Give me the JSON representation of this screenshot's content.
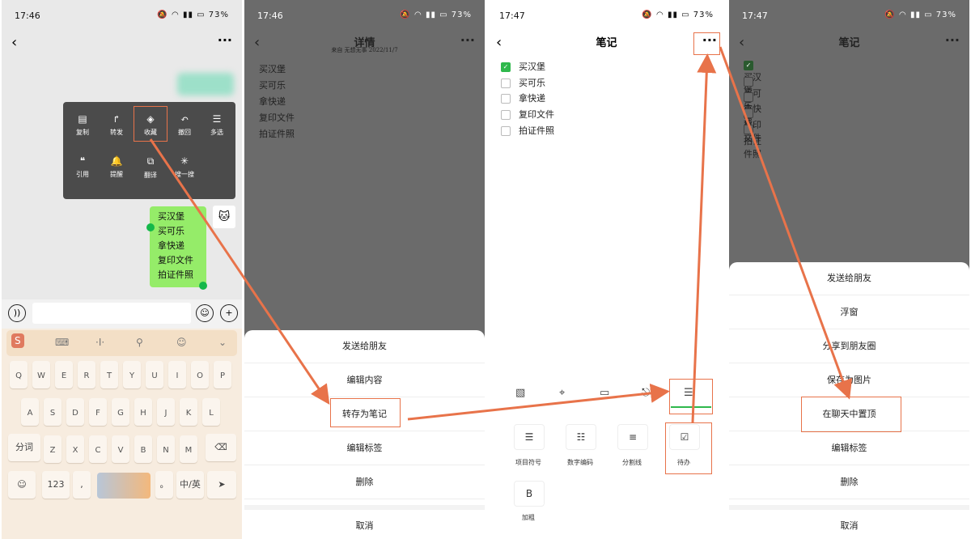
{
  "status": {
    "time1": "17:46",
    "time2": "17:46",
    "time3": "17:47",
    "time4": "17:47",
    "battery": "73%"
  },
  "panel1": {
    "context_menu": {
      "row1": [
        {
          "label": "复制",
          "icon": "doc-icon"
        },
        {
          "label": "转发",
          "icon": "share-arrow-icon"
        },
        {
          "label": "收藏",
          "icon": "cube-icon"
        },
        {
          "label": "撤回",
          "icon": "undo-icon"
        },
        {
          "label": "多选",
          "icon": "list-icon"
        }
      ],
      "row2": [
        {
          "label": "引用",
          "icon": "quote-icon"
        },
        {
          "label": "提醒",
          "icon": "bell-icon"
        },
        {
          "label": "翻译",
          "icon": "translate-icon"
        },
        {
          "label": "搜一搜",
          "icon": "spark-icon"
        }
      ]
    },
    "bubble_lines": [
      "买汉堡",
      "买可乐",
      "拿快递",
      "复印文件",
      "拍证件照"
    ],
    "keyboard": {
      "row1": [
        "Q",
        "W",
        "E",
        "R",
        "T",
        "Y",
        "U",
        "I",
        "O",
        "P"
      ],
      "row2": [
        "A",
        "S",
        "D",
        "F",
        "G",
        "H",
        "J",
        "K",
        "L"
      ],
      "row3": [
        "Z",
        "X",
        "C",
        "V",
        "B",
        "N",
        "M"
      ],
      "fenci": "分词",
      "num": "123",
      "comma": ",",
      "period": "。",
      "zh": "中/英"
    }
  },
  "panel2": {
    "title": "详情",
    "subtitle": "来自 无想无事 2022/11/7",
    "notes": [
      "买汉堡",
      "买可乐",
      "拿快递",
      "复印文件",
      "拍证件照"
    ],
    "sheet": [
      "发送给朋友",
      "编辑内容",
      "转存为笔记",
      "编辑标签",
      "删除"
    ],
    "cancel": "取消"
  },
  "panel3": {
    "title": "笔记",
    "todos": [
      {
        "text": "买汉堡",
        "checked": true
      },
      {
        "text": "买可乐",
        "checked": false
      },
      {
        "text": "拿快递",
        "checked": false
      },
      {
        "text": "复印文件",
        "checked": false
      },
      {
        "text": "拍证件照",
        "checked": false
      }
    ],
    "format_buttons": [
      {
        "label": "项目符号",
        "glyph": "☰"
      },
      {
        "label": "数字编码",
        "glyph": "☷"
      },
      {
        "label": "分割线",
        "glyph": "≡"
      },
      {
        "label": "待办",
        "glyph": "☑"
      },
      {
        "label": "加粗",
        "glyph": "B"
      }
    ]
  },
  "panel4": {
    "title": "笔记",
    "notes": [
      "买汉堡",
      "买可乐",
      "拿快递",
      "复印文件",
      "拍证件照"
    ],
    "sheet": [
      "发送给朋友",
      "浮窗",
      "分享到朋友圈",
      "保存为图片",
      "在聊天中置顶",
      "编辑标签",
      "删除"
    ],
    "cancel": "取消"
  },
  "colors": {
    "highlight": "#e8734a",
    "chat_bubble": "#95ec69",
    "check": "#2fb84c"
  }
}
